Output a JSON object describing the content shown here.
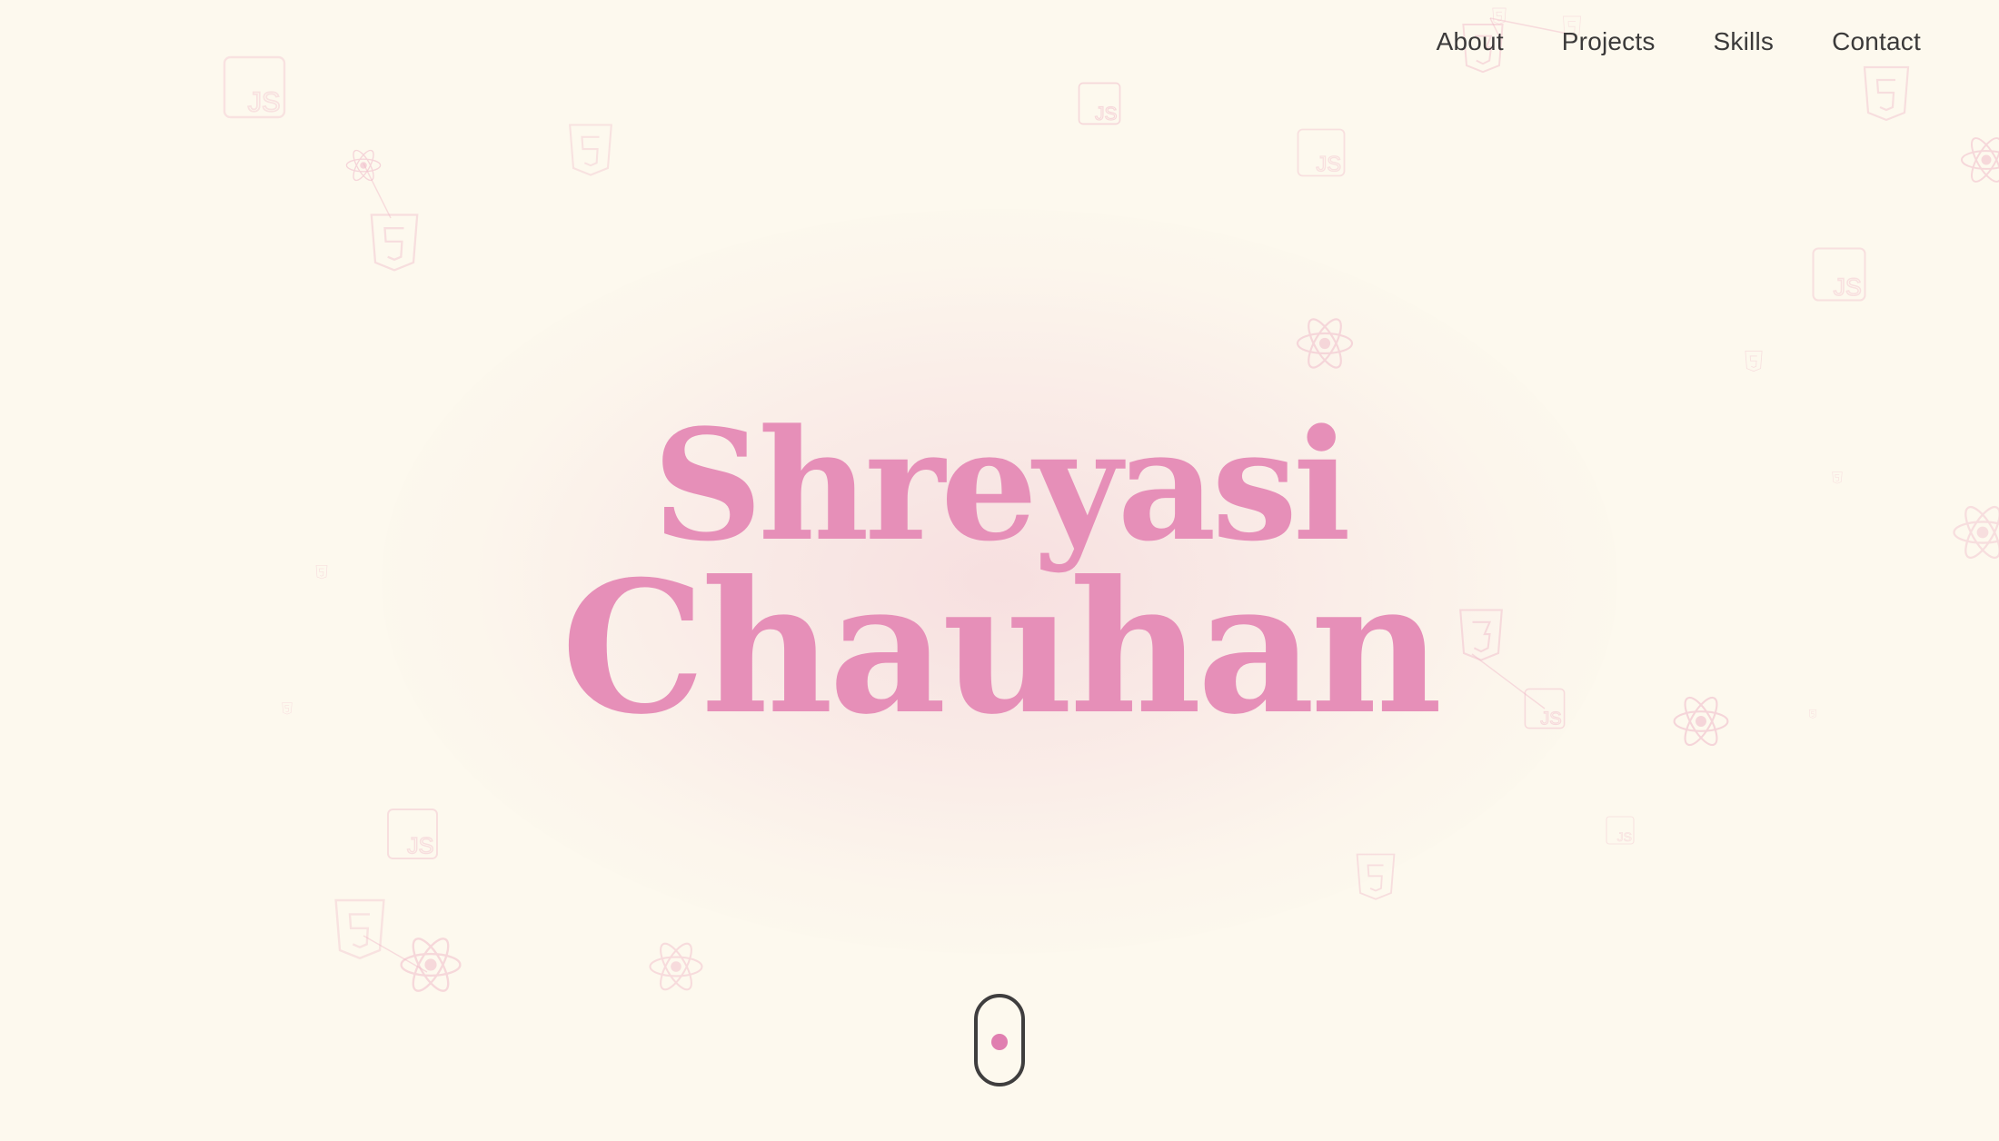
{
  "nav": {
    "items": [
      "About",
      "Projects",
      "Skills",
      "Contact"
    ]
  },
  "hero": {
    "first_name": "Shreyasi",
    "last_name": "Chauhan"
  },
  "colors": {
    "background": "#fdf9ee",
    "accent": "#e68fb8",
    "nav_text": "#3b3a3a",
    "icon_stroke": "#f0b8c8"
  },
  "background_icons": {
    "js_label": "JS",
    "types": [
      "js-icon",
      "html5-icon",
      "css3-icon",
      "react-icon"
    ]
  }
}
